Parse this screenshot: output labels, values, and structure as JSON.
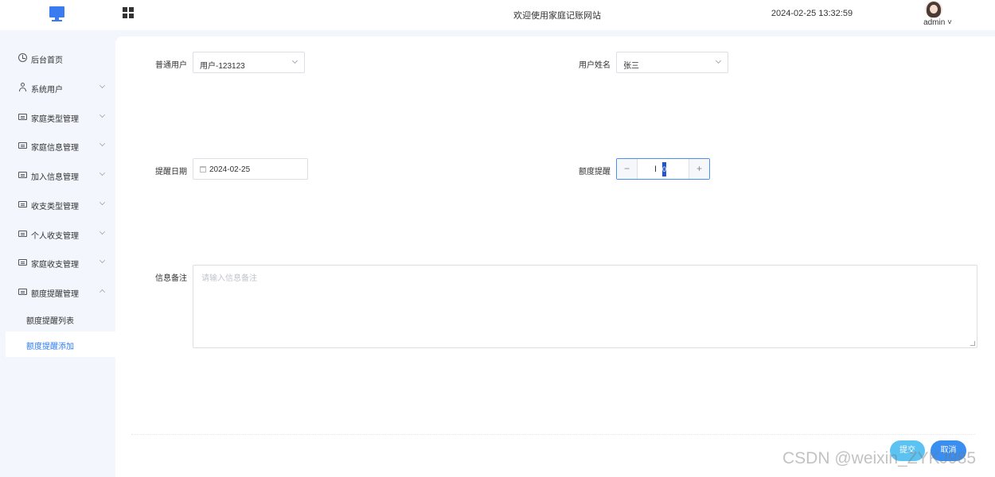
{
  "header": {
    "welcome": "欢迎使用家庭记账网站",
    "datetime": "2024-02-25 13:32:59",
    "user": "admin ˅"
  },
  "sidebar": {
    "items": [
      {
        "label": "后台首页",
        "icon": "clock-icon"
      },
      {
        "label": "系统用户",
        "icon": "user-icon"
      },
      {
        "label": "家庭类型管理",
        "icon": "list-icon"
      },
      {
        "label": "家庭信息管理",
        "icon": "list-icon"
      },
      {
        "label": "加入信息管理",
        "icon": "list-icon"
      },
      {
        "label": "收支类型管理",
        "icon": "list-icon"
      },
      {
        "label": "个人收支管理",
        "icon": "list-icon"
      },
      {
        "label": "家庭收支管理",
        "icon": "list-icon"
      },
      {
        "label": "额度提醒管理",
        "icon": "list-icon"
      }
    ],
    "sub_items": [
      {
        "label": "额度提醒列表"
      },
      {
        "label": "额度提醒添加"
      }
    ]
  },
  "form": {
    "user_label": "普通用户",
    "user_value": "用户-123123",
    "name_label": "用户姓名",
    "name_value": "张三",
    "date_label": "提醒日期",
    "date_value": "2024-02-25",
    "quota_label": "额度提醒",
    "quota_minus": "−",
    "quota_plus": "+",
    "quota_value": "0",
    "note_label": "信息备注",
    "note_placeholder": "请输入信息备注",
    "submit_label": "提交",
    "cancel_label": "取消"
  },
  "watermark": "CSDN @weixin_ZYKJ985",
  "colors": {
    "accent": "#3a8ef0",
    "active_text": "#2f7ef0",
    "submit": "#5cc2f2",
    "sidebar_bg": "#f3f6fc"
  }
}
